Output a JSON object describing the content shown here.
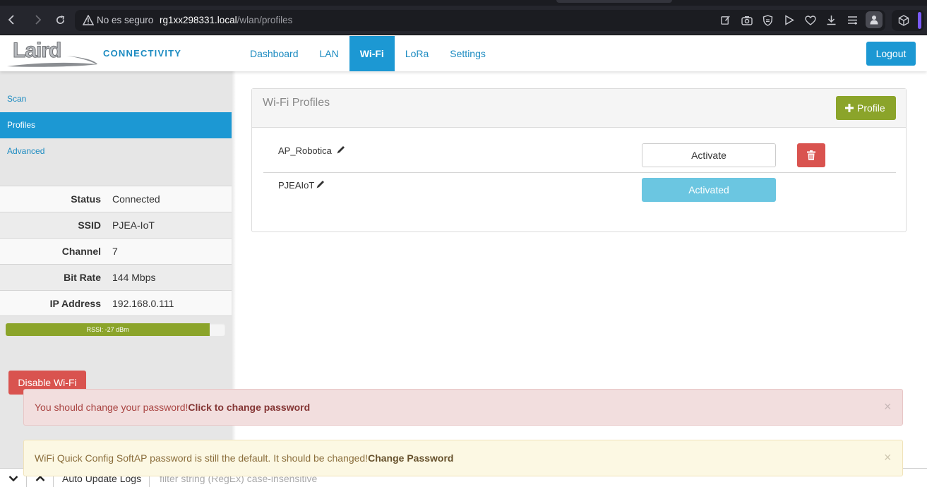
{
  "browser": {
    "security_label": "No es seguro",
    "url_host": "rg1xx298331.local",
    "url_path": "/wlan/profiles",
    "icons": [
      "back-icon",
      "forward-icon",
      "reload-icon",
      "not-secure-icon",
      "edit-page-icon",
      "camera-icon",
      "shield-icon",
      "play-icon",
      "heart-icon",
      "download-icon",
      "menu-icon",
      "profile-icon",
      "wallet-icon"
    ],
    "accent_color": "#7a5af8"
  },
  "header": {
    "logo_text": "Laird",
    "brand_sub": "CONNECTIVITY",
    "nav": [
      {
        "label": "Dashboard"
      },
      {
        "label": "LAN"
      },
      {
        "label": "Wi-Fi"
      },
      {
        "label": "LoRa"
      },
      {
        "label": "Settings"
      }
    ],
    "active_nav": "Wi-Fi",
    "logout_label": "Logout",
    "brand_color": "#1c98d3"
  },
  "sidebar": {
    "links": [
      {
        "label": "Scan"
      },
      {
        "label": "Profiles"
      },
      {
        "label": "Advanced"
      }
    ],
    "active_link": "Profiles",
    "info": [
      {
        "label": "Status",
        "value": "Connected"
      },
      {
        "label": "SSID",
        "value": "PJEA-IoT"
      },
      {
        "label": "Channel",
        "value": "7"
      },
      {
        "label": "Bit Rate",
        "value": "144 Mbps"
      },
      {
        "label": "IP Address",
        "value": "192.168.0.111"
      }
    ],
    "rssi": {
      "label": "RSSI: -27 dBm",
      "level": 0.93,
      "color": "#8ba42a"
    },
    "disable_label": "Disable Wi-Fi"
  },
  "panel": {
    "title": "Wi-Fi Profiles",
    "add_label": "Profile",
    "profiles": [
      {
        "name": "AP_Robotica",
        "action": "Activate",
        "active": false
      },
      {
        "name": "PJEAIoT",
        "action": "Activated",
        "active": true
      }
    ]
  },
  "alerts": {
    "danger": {
      "text": "You should change your password!",
      "link": "Click to change password",
      "close": "×"
    },
    "warning": {
      "text": "WiFi Quick Config SoftAP password is still the default. It should be changed!",
      "link": "Change Password",
      "close": "×"
    }
  },
  "logbar": {
    "label": "Auto Update Logs",
    "filter_placeholder": "filter string (RegEx) case-insensitive"
  }
}
